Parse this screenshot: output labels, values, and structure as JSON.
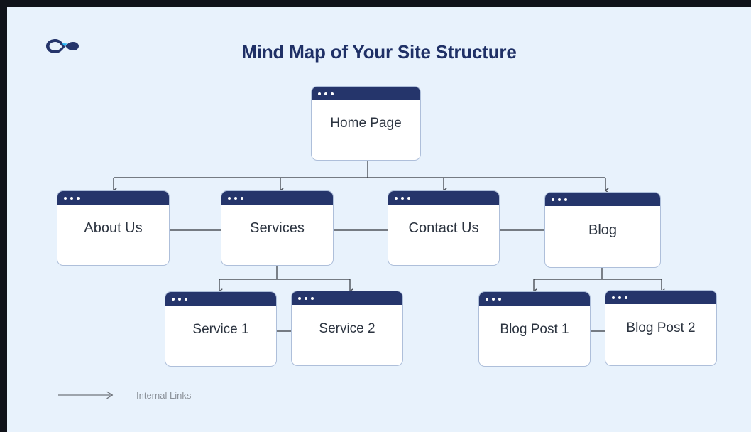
{
  "page": {
    "title": "Mind Map of Your Site Structure",
    "background_color": "#e8f2fc",
    "accent_color": "#25356b",
    "logo_name": "infinity-logo"
  },
  "diagram": {
    "nodes": [
      {
        "id": "home",
        "label": "Home Page",
        "level": 0
      },
      {
        "id": "about",
        "label": "About Us",
        "level": 1
      },
      {
        "id": "services",
        "label": "Services",
        "level": 1
      },
      {
        "id": "contact",
        "label": "Contact Us",
        "level": 1
      },
      {
        "id": "blog",
        "label": "Blog",
        "level": 1
      },
      {
        "id": "service1",
        "label": "Service 1",
        "level": 2
      },
      {
        "id": "service2",
        "label": "Service 2",
        "level": 2
      },
      {
        "id": "blogpost1",
        "label": "Blog Post 1",
        "level": 2
      },
      {
        "id": "blogpost2",
        "label": "Blog Post 2",
        "level": 2
      }
    ],
    "edges": [
      {
        "from": "home",
        "to": "about",
        "kind": "arrow"
      },
      {
        "from": "home",
        "to": "services",
        "kind": "arrow"
      },
      {
        "from": "home",
        "to": "contact",
        "kind": "arrow"
      },
      {
        "from": "home",
        "to": "blog",
        "kind": "arrow"
      },
      {
        "from": "services",
        "to": "service1",
        "kind": "arrow"
      },
      {
        "from": "services",
        "to": "service2",
        "kind": "arrow"
      },
      {
        "from": "blog",
        "to": "blogpost1",
        "kind": "arrow"
      },
      {
        "from": "blog",
        "to": "blogpost2",
        "kind": "arrow"
      },
      {
        "from": "about",
        "to": "services",
        "kind": "line"
      },
      {
        "from": "services",
        "to": "contact",
        "kind": "line"
      },
      {
        "from": "contact",
        "to": "blog",
        "kind": "line"
      },
      {
        "from": "service1",
        "to": "service2",
        "kind": "line"
      },
      {
        "from": "blogpost1",
        "to": "blogpost2",
        "kind": "line"
      }
    ]
  },
  "legend": {
    "label": "Internal Links",
    "arrow_name": "internal-links-arrow",
    "color": "#8b9199"
  }
}
